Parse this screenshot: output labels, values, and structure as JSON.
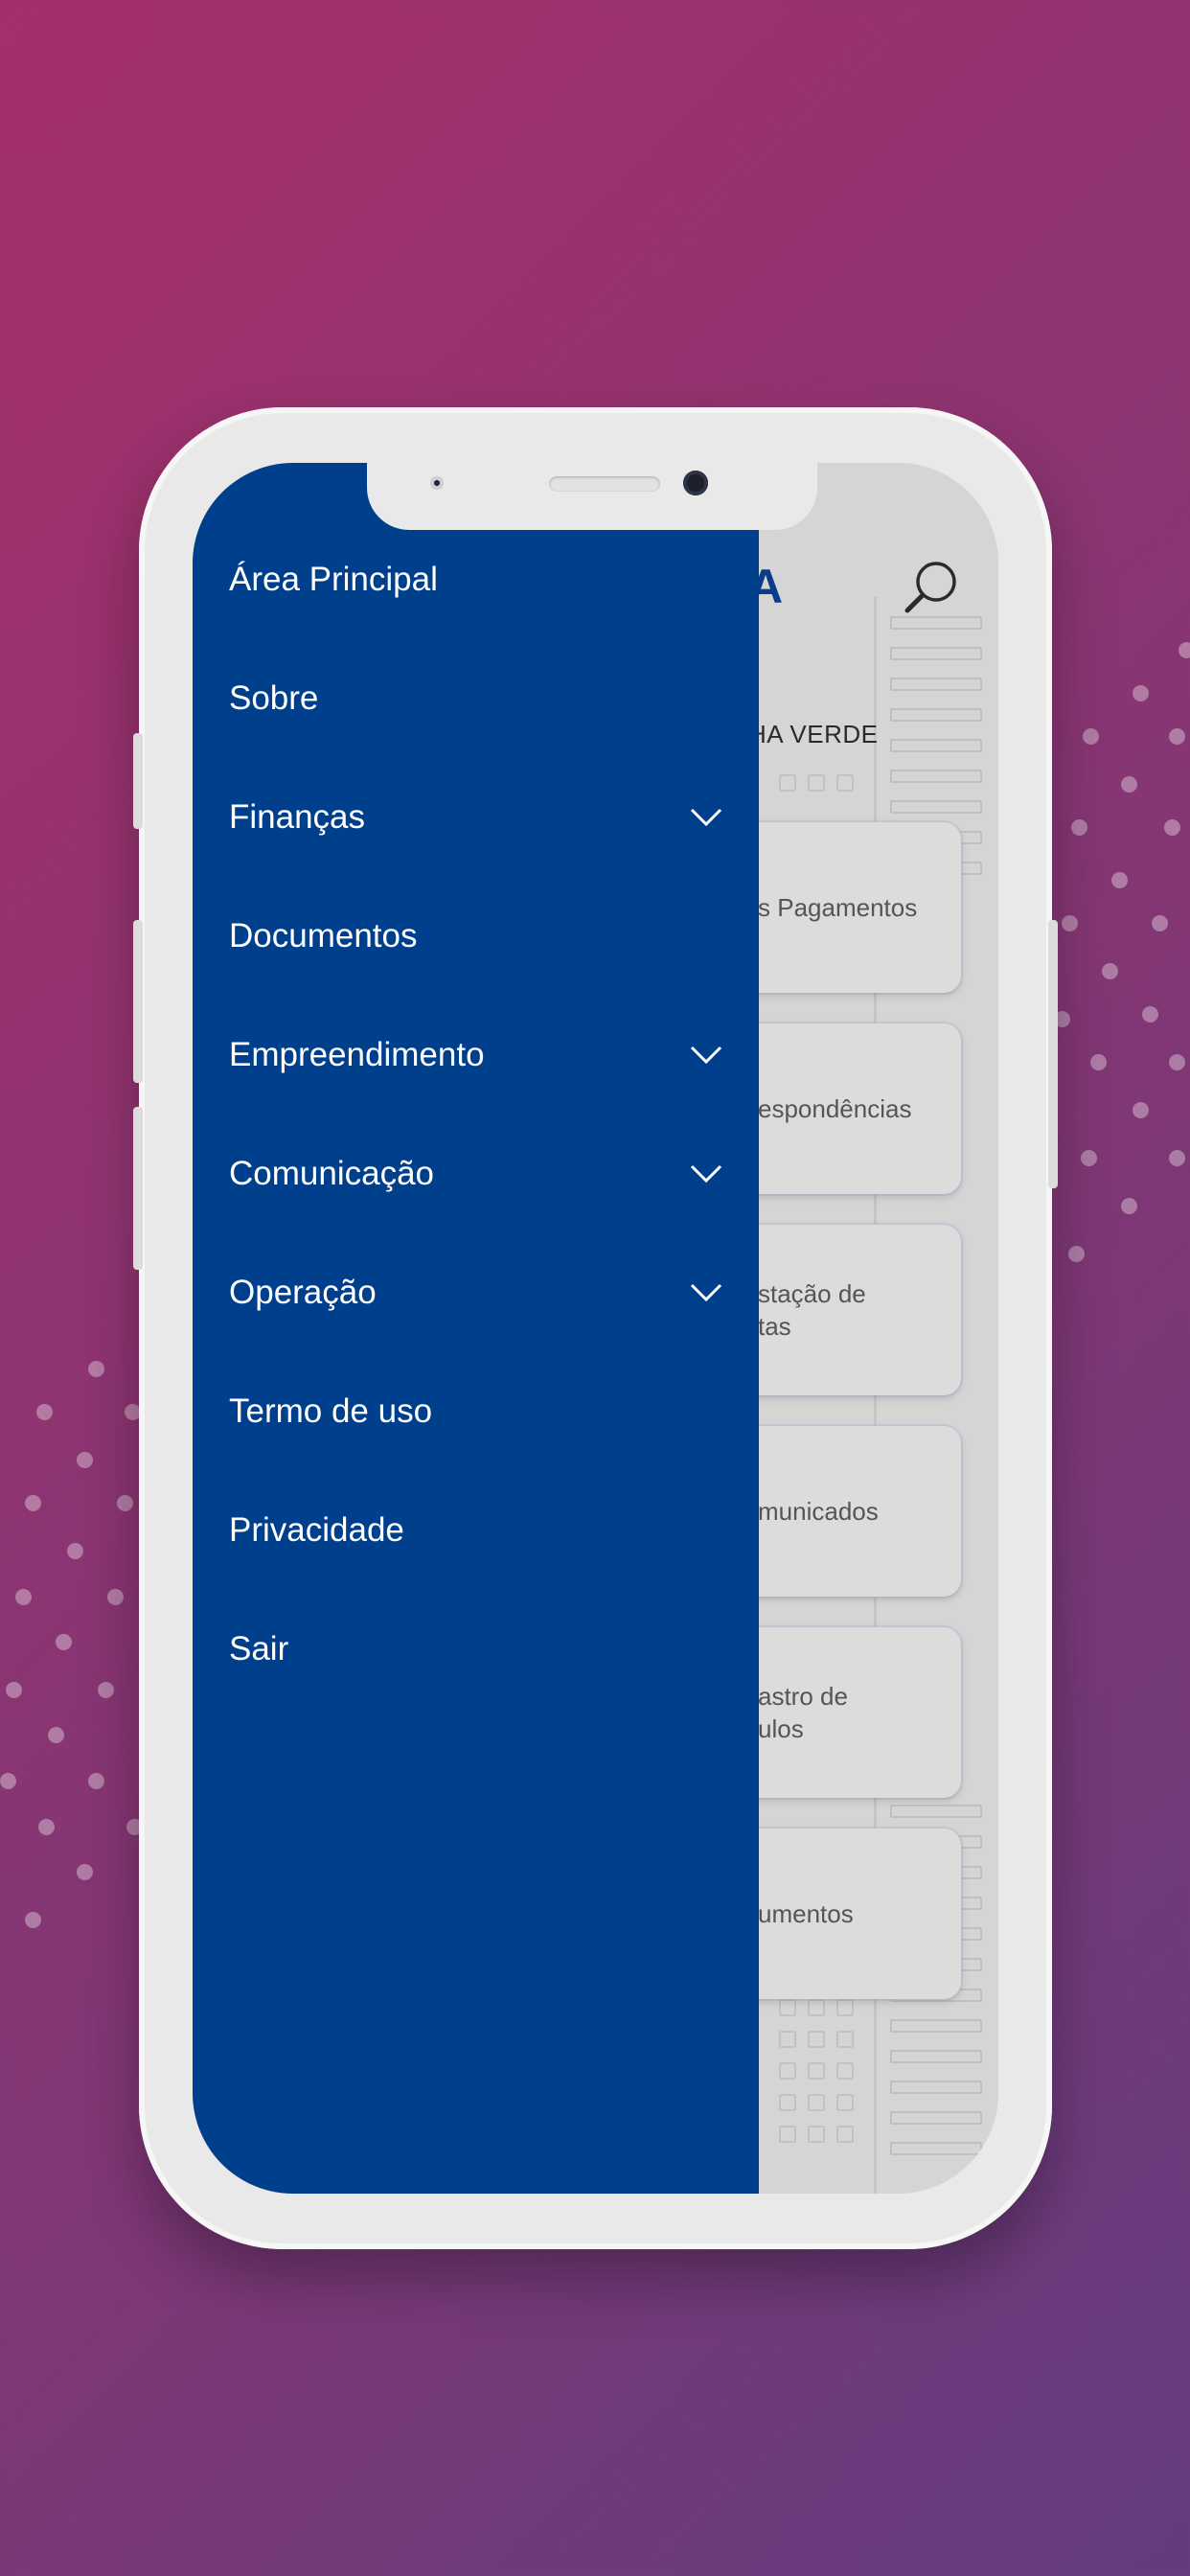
{
  "menu": {
    "items": [
      {
        "label": "Área Principal",
        "expandable": false
      },
      {
        "label": "Sobre",
        "expandable": false
      },
      {
        "label": "Finanças",
        "expandable": true
      },
      {
        "label": "Documentos",
        "expandable": false
      },
      {
        "label": "Empreendimento",
        "expandable": true
      },
      {
        "label": "Comunicação",
        "expandable": true
      },
      {
        "label": "Operação",
        "expandable": true
      },
      {
        "label": "Termo de uso",
        "expandable": false
      },
      {
        "label": "Privacidade",
        "expandable": false
      },
      {
        "label": "Sair",
        "expandable": false
      }
    ]
  },
  "app": {
    "logo_fragment": "A",
    "title_fragment": "HA VERDE",
    "cards": [
      {
        "label": "s Pagamentos"
      },
      {
        "label": "espondências"
      },
      {
        "label": "stação de\ntas"
      },
      {
        "label": "municados"
      },
      {
        "label": "astro de\nulos"
      },
      {
        "label": "umentos"
      }
    ]
  },
  "icons": {
    "search": "search-icon",
    "expand": "chevron-down-icon"
  },
  "colors": {
    "drawer": "#003f8b",
    "background_start": "#a52f6a",
    "background_end": "#633c7e",
    "logo": "#0b3c8a"
  }
}
